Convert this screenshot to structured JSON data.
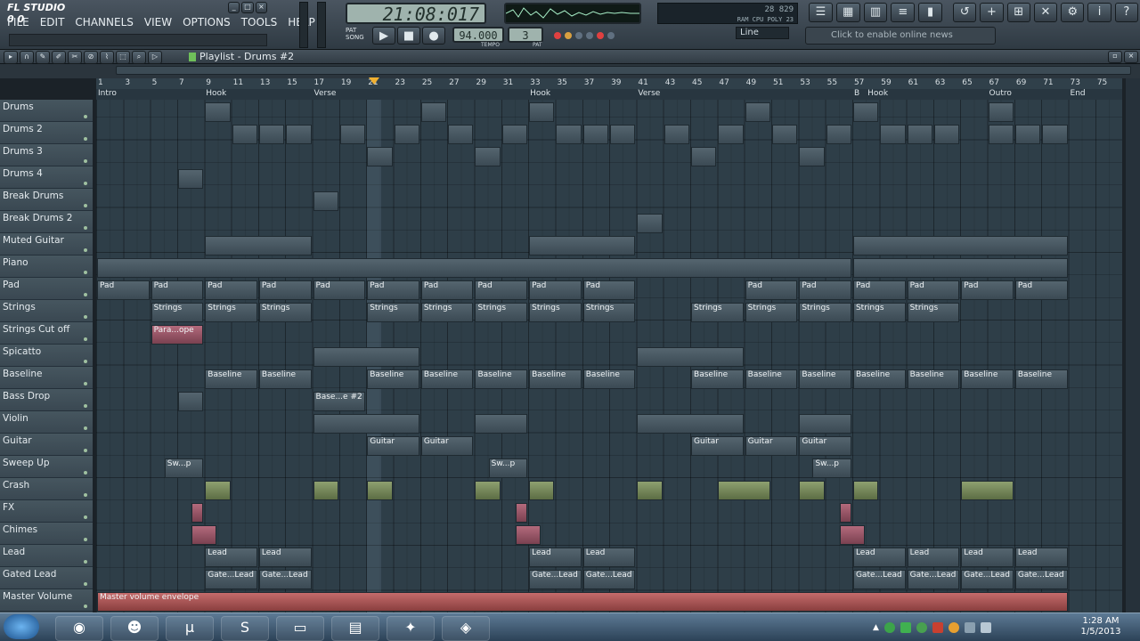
{
  "app": {
    "title": "FL STUDIO",
    "title_counts": [
      "0",
      "0"
    ]
  },
  "menu": [
    "FILE",
    "EDIT",
    "CHANNELS",
    "VIEW",
    "OPTIONS",
    "TOOLS",
    "HELP"
  ],
  "transport": {
    "clock": "21:08:017",
    "tempo": "94.000",
    "tempo_label": "TEMPO",
    "pattern": "3",
    "pattern_label": "PAT",
    "pat_song": [
      "PAT",
      "SONG"
    ]
  },
  "cpu": {
    "line1": "28  829",
    "line2": "RAM  CPU  POLY  23"
  },
  "snap": "Line",
  "news": "Click to enable online news",
  "playlist": {
    "title": "Playlist - Drums #2"
  },
  "ruler": [
    "1",
    "3",
    "5",
    "7",
    "9",
    "11",
    "13",
    "15",
    "17",
    "19",
    "21",
    "23",
    "25",
    "27",
    "29",
    "31",
    "33",
    "35",
    "37",
    "39",
    "41",
    "43",
    "45",
    "47",
    "49",
    "51",
    "53",
    "55",
    "57",
    "59",
    "61",
    "63",
    "65",
    "67",
    "69",
    "71",
    "73",
    "75"
  ],
  "markers": [
    {
      "label": "Intro",
      "bar": 1
    },
    {
      "label": "Hook",
      "bar": 9
    },
    {
      "label": "Verse",
      "bar": 17
    },
    {
      "label": "Hook",
      "bar": 33
    },
    {
      "label": "Verse",
      "bar": 41
    },
    {
      "label": "B",
      "bar": 57
    },
    {
      "label": "Hook",
      "bar": 58
    },
    {
      "label": "Outro",
      "bar": 67
    },
    {
      "label": "End",
      "bar": 73
    }
  ],
  "tracks": [
    "Drums",
    "Drums 2",
    "Drums 3",
    "Drums 4",
    "Break Drums",
    "Break Drums 2",
    "Muted Guitar",
    "Piano",
    "Pad",
    "Strings",
    "Strings Cut off",
    "Spicatto",
    "Baseline",
    "Bass Drop",
    "Violin",
    "Guitar",
    "Sweep Up",
    "Crash",
    "FX",
    "Chimes",
    "Lead",
    "Gated Lead",
    "Master Volume"
  ],
  "clips": [
    {
      "t": 0,
      "s": 9,
      "l": 2,
      "n": ""
    },
    {
      "t": 0,
      "s": 25,
      "l": 2,
      "n": ""
    },
    {
      "t": 0,
      "s": 33,
      "l": 2,
      "n": ""
    },
    {
      "t": 0,
      "s": 49,
      "l": 2,
      "n": ""
    },
    {
      "t": 0,
      "s": 57,
      "l": 2,
      "n": ""
    },
    {
      "t": 0,
      "s": 67,
      "l": 2,
      "n": ""
    },
    {
      "t": 1,
      "s": 11,
      "l": 2,
      "n": ""
    },
    {
      "t": 1,
      "s": 13,
      "l": 2,
      "n": ""
    },
    {
      "t": 1,
      "s": 15,
      "l": 2,
      "n": ""
    },
    {
      "t": 1,
      "s": 19,
      "l": 2,
      "n": ""
    },
    {
      "t": 1,
      "s": 23,
      "l": 2,
      "n": ""
    },
    {
      "t": 1,
      "s": 27,
      "l": 2,
      "n": ""
    },
    {
      "t": 1,
      "s": 31,
      "l": 2,
      "n": ""
    },
    {
      "t": 1,
      "s": 35,
      "l": 2,
      "n": ""
    },
    {
      "t": 1,
      "s": 37,
      "l": 2,
      "n": ""
    },
    {
      "t": 1,
      "s": 39,
      "l": 2,
      "n": ""
    },
    {
      "t": 1,
      "s": 43,
      "l": 2,
      "n": ""
    },
    {
      "t": 1,
      "s": 47,
      "l": 2,
      "n": ""
    },
    {
      "t": 1,
      "s": 51,
      "l": 2,
      "n": ""
    },
    {
      "t": 1,
      "s": 55,
      "l": 2,
      "n": ""
    },
    {
      "t": 1,
      "s": 59,
      "l": 2,
      "n": ""
    },
    {
      "t": 1,
      "s": 61,
      "l": 2,
      "n": ""
    },
    {
      "t": 1,
      "s": 63,
      "l": 2,
      "n": ""
    },
    {
      "t": 1,
      "s": 67,
      "l": 2,
      "n": ""
    },
    {
      "t": 1,
      "s": 69,
      "l": 2,
      "n": ""
    },
    {
      "t": 1,
      "s": 71,
      "l": 2,
      "n": ""
    },
    {
      "t": 2,
      "s": 21,
      "l": 2,
      "n": ""
    },
    {
      "t": 2,
      "s": 29,
      "l": 2,
      "n": ""
    },
    {
      "t": 2,
      "s": 45,
      "l": 2,
      "n": ""
    },
    {
      "t": 2,
      "s": 53,
      "l": 2,
      "n": ""
    },
    {
      "t": 3,
      "s": 7,
      "l": 2,
      "n": ""
    },
    {
      "t": 4,
      "s": 17,
      "l": 2,
      "n": ""
    },
    {
      "t": 5,
      "s": 41,
      "l": 2,
      "n": ""
    },
    {
      "t": 6,
      "s": 9,
      "l": 8,
      "n": ""
    },
    {
      "t": 6,
      "s": 33,
      "l": 8,
      "n": ""
    },
    {
      "t": 6,
      "s": 57,
      "l": 16,
      "n": ""
    },
    {
      "t": 7,
      "s": 1,
      "l": 56,
      "n": ""
    },
    {
      "t": 7,
      "s": 57,
      "l": 16,
      "n": ""
    },
    {
      "t": 8,
      "s": 1,
      "l": 4,
      "n": "Pad"
    },
    {
      "t": 8,
      "s": 5,
      "l": 4,
      "n": "Pad"
    },
    {
      "t": 8,
      "s": 9,
      "l": 4,
      "n": "Pad"
    },
    {
      "t": 8,
      "s": 13,
      "l": 4,
      "n": "Pad"
    },
    {
      "t": 8,
      "s": 17,
      "l": 4,
      "n": "Pad"
    },
    {
      "t": 8,
      "s": 21,
      "l": 4,
      "n": "Pad"
    },
    {
      "t": 8,
      "s": 25,
      "l": 4,
      "n": "Pad"
    },
    {
      "t": 8,
      "s": 29,
      "l": 4,
      "n": "Pad"
    },
    {
      "t": 8,
      "s": 33,
      "l": 4,
      "n": "Pad"
    },
    {
      "t": 8,
      "s": 37,
      "l": 4,
      "n": "Pad"
    },
    {
      "t": 8,
      "s": 49,
      "l": 4,
      "n": "Pad"
    },
    {
      "t": 8,
      "s": 53,
      "l": 4,
      "n": "Pad"
    },
    {
      "t": 8,
      "s": 57,
      "l": 4,
      "n": "Pad"
    },
    {
      "t": 8,
      "s": 61,
      "l": 4,
      "n": "Pad"
    },
    {
      "t": 8,
      "s": 65,
      "l": 4,
      "n": "Pad"
    },
    {
      "t": 8,
      "s": 69,
      "l": 4,
      "n": "Pad"
    },
    {
      "t": 9,
      "s": 5,
      "l": 4,
      "n": "Strings"
    },
    {
      "t": 9,
      "s": 9,
      "l": 4,
      "n": "Strings"
    },
    {
      "t": 9,
      "s": 13,
      "l": 4,
      "n": "Strings"
    },
    {
      "t": 9,
      "s": 21,
      "l": 4,
      "n": "Strings"
    },
    {
      "t": 9,
      "s": 25,
      "l": 4,
      "n": "Strings"
    },
    {
      "t": 9,
      "s": 29,
      "l": 4,
      "n": "Strings"
    },
    {
      "t": 9,
      "s": 33,
      "l": 4,
      "n": "Strings"
    },
    {
      "t": 9,
      "s": 37,
      "l": 4,
      "n": "Strings"
    },
    {
      "t": 9,
      "s": 45,
      "l": 4,
      "n": "Strings"
    },
    {
      "t": 9,
      "s": 49,
      "l": 4,
      "n": "Strings"
    },
    {
      "t": 9,
      "s": 53,
      "l": 4,
      "n": "Strings"
    },
    {
      "t": 9,
      "s": 57,
      "l": 4,
      "n": "Strings"
    },
    {
      "t": 9,
      "s": 61,
      "l": 4,
      "n": "Strings"
    },
    {
      "t": 10,
      "s": 5,
      "l": 4,
      "n": "Para...ope",
      "c": "pink"
    },
    {
      "t": 11,
      "s": 17,
      "l": 8,
      "n": ""
    },
    {
      "t": 11,
      "s": 41,
      "l": 8,
      "n": ""
    },
    {
      "t": 12,
      "s": 9,
      "l": 4,
      "n": "Baseline"
    },
    {
      "t": 12,
      "s": 13,
      "l": 4,
      "n": "Baseline"
    },
    {
      "t": 12,
      "s": 21,
      "l": 4,
      "n": "Baseline"
    },
    {
      "t": 12,
      "s": 25,
      "l": 4,
      "n": "Baseline"
    },
    {
      "t": 12,
      "s": 29,
      "l": 4,
      "n": "Baseline"
    },
    {
      "t": 12,
      "s": 33,
      "l": 4,
      "n": "Baseline"
    },
    {
      "t": 12,
      "s": 37,
      "l": 4,
      "n": "Baseline"
    },
    {
      "t": 12,
      "s": 45,
      "l": 4,
      "n": "Baseline"
    },
    {
      "t": 12,
      "s": 49,
      "l": 4,
      "n": "Baseline"
    },
    {
      "t": 12,
      "s": 53,
      "l": 4,
      "n": "Baseline"
    },
    {
      "t": 12,
      "s": 57,
      "l": 4,
      "n": "Baseline"
    },
    {
      "t": 12,
      "s": 61,
      "l": 4,
      "n": "Baseline"
    },
    {
      "t": 12,
      "s": 65,
      "l": 4,
      "n": "Baseline"
    },
    {
      "t": 12,
      "s": 69,
      "l": 4,
      "n": "Baseline"
    },
    {
      "t": 13,
      "s": 7,
      "l": 2,
      "n": ""
    },
    {
      "t": 13,
      "s": 17,
      "l": 4,
      "n": "Base...e #2"
    },
    {
      "t": 14,
      "s": 17,
      "l": 8,
      "n": ""
    },
    {
      "t": 14,
      "s": 29,
      "l": 4,
      "n": ""
    },
    {
      "t": 14,
      "s": 41,
      "l": 8,
      "n": ""
    },
    {
      "t": 14,
      "s": 53,
      "l": 4,
      "n": ""
    },
    {
      "t": 15,
      "s": 21,
      "l": 4,
      "n": "Guitar"
    },
    {
      "t": 15,
      "s": 25,
      "l": 4,
      "n": "Guitar"
    },
    {
      "t": 15,
      "s": 45,
      "l": 4,
      "n": "Guitar"
    },
    {
      "t": 15,
      "s": 49,
      "l": 4,
      "n": "Guitar"
    },
    {
      "t": 15,
      "s": 53,
      "l": 4,
      "n": "Guitar"
    },
    {
      "t": 16,
      "s": 6,
      "l": 3,
      "n": "Sw...p"
    },
    {
      "t": 16,
      "s": 30,
      "l": 3,
      "n": "Sw...p"
    },
    {
      "t": 16,
      "s": 54,
      "l": 3,
      "n": "Sw...p"
    },
    {
      "t": 17,
      "s": 9,
      "l": 2,
      "n": "",
      "c": "green"
    },
    {
      "t": 17,
      "s": 17,
      "l": 2,
      "n": "",
      "c": "green"
    },
    {
      "t": 17,
      "s": 21,
      "l": 2,
      "n": "",
      "c": "green"
    },
    {
      "t": 17,
      "s": 29,
      "l": 2,
      "n": "",
      "c": "green"
    },
    {
      "t": 17,
      "s": 33,
      "l": 2,
      "n": "",
      "c": "green"
    },
    {
      "t": 17,
      "s": 41,
      "l": 2,
      "n": "",
      "c": "green"
    },
    {
      "t": 17,
      "s": 47,
      "l": 4,
      "n": "",
      "c": "green"
    },
    {
      "t": 17,
      "s": 53,
      "l": 2,
      "n": "",
      "c": "green"
    },
    {
      "t": 17,
      "s": 57,
      "l": 2,
      "n": "",
      "c": "green"
    },
    {
      "t": 17,
      "s": 65,
      "l": 4,
      "n": "",
      "c": "green"
    },
    {
      "t": 18,
      "s": 8,
      "l": 1,
      "n": "",
      "c": "pink"
    },
    {
      "t": 18,
      "s": 32,
      "l": 1,
      "n": "",
      "c": "pink"
    },
    {
      "t": 18,
      "s": 56,
      "l": 1,
      "n": "",
      "c": "pink"
    },
    {
      "t": 19,
      "s": 8,
      "l": 2,
      "n": "",
      "c": "pink"
    },
    {
      "t": 19,
      "s": 32,
      "l": 2,
      "n": "",
      "c": "pink"
    },
    {
      "t": 19,
      "s": 56,
      "l": 2,
      "n": "",
      "c": "pink"
    },
    {
      "t": 20,
      "s": 9,
      "l": 4,
      "n": "Lead"
    },
    {
      "t": 20,
      "s": 13,
      "l": 4,
      "n": "Lead"
    },
    {
      "t": 20,
      "s": 33,
      "l": 4,
      "n": "Lead"
    },
    {
      "t": 20,
      "s": 37,
      "l": 4,
      "n": "Lead"
    },
    {
      "t": 20,
      "s": 57,
      "l": 4,
      "n": "Lead"
    },
    {
      "t": 20,
      "s": 61,
      "l": 4,
      "n": "Lead"
    },
    {
      "t": 20,
      "s": 65,
      "l": 4,
      "n": "Lead"
    },
    {
      "t": 20,
      "s": 69,
      "l": 4,
      "n": "Lead"
    },
    {
      "t": 21,
      "s": 9,
      "l": 4,
      "n": "Gate...Lead"
    },
    {
      "t": 21,
      "s": 13,
      "l": 4,
      "n": "Gate...Lead"
    },
    {
      "t": 21,
      "s": 33,
      "l": 4,
      "n": "Gate...Lead"
    },
    {
      "t": 21,
      "s": 37,
      "l": 4,
      "n": "Gate...Lead"
    },
    {
      "t": 21,
      "s": 57,
      "l": 4,
      "n": "Gate...Lead"
    },
    {
      "t": 21,
      "s": 61,
      "l": 4,
      "n": "Gate...Lead"
    },
    {
      "t": 21,
      "s": 65,
      "l": 4,
      "n": "Gate...Lead"
    },
    {
      "t": 21,
      "s": 69,
      "l": 4,
      "n": "Gate...Lead"
    },
    {
      "t": 22,
      "s": 1,
      "l": 72,
      "n": "Master volume envelope",
      "c": "master"
    }
  ],
  "taskbar": {
    "icons": [
      "firefox-icon",
      "messenger-icon",
      "utorrent-icon",
      "skype-icon",
      "folder-icon",
      "book-icon",
      "fl-studio-icon",
      "app-icon"
    ],
    "time": "1:28 AM",
    "date": "1/5/2013"
  },
  "colors": {
    "accent": "#3a8fd0",
    "clip": "#55656f",
    "pink": "#b36a7c",
    "green": "#8ea070"
  }
}
